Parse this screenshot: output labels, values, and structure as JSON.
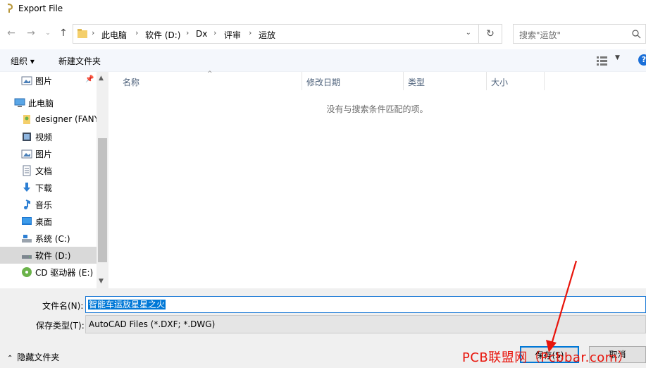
{
  "window": {
    "title": "Export File"
  },
  "nav": {
    "breadcrumbs": [
      "此电脑",
      "软件 (D:)",
      "Dx",
      "评审",
      "运放"
    ],
    "search_placeholder": "搜索\"运放\""
  },
  "toolbar": {
    "organize_label": "组织 ▾",
    "new_folder_label": "新建文件夹"
  },
  "sidebar": {
    "items": [
      {
        "label": "图片",
        "icon": "pictures-icon"
      },
      {
        "label": "此电脑",
        "icon": "computer-icon"
      },
      {
        "label": "designer (FANY",
        "icon": "user-folder-icon"
      },
      {
        "label": "视频",
        "icon": "video-icon"
      },
      {
        "label": "图片",
        "icon": "pictures-icon"
      },
      {
        "label": "文档",
        "icon": "documents-icon"
      },
      {
        "label": "下载",
        "icon": "download-icon"
      },
      {
        "label": "音乐",
        "icon": "music-icon"
      },
      {
        "label": "桌面",
        "icon": "desktop-icon"
      },
      {
        "label": "系统 (C:)",
        "icon": "drive-c-icon"
      },
      {
        "label": "软件 (D:)",
        "icon": "drive-d-icon"
      },
      {
        "label": "CD 驱动器 (E:) H",
        "icon": "cd-drive-icon"
      }
    ]
  },
  "filelist": {
    "columns": [
      "名称",
      "修改日期",
      "类型",
      "大小"
    ],
    "empty_message": "没有与搜索条件匹配的项。"
  },
  "form": {
    "filename_label": "文件名(N):",
    "filename_value": "智能车运放星星之火",
    "filetype_label": "保存类型(T):",
    "filetype_value": "AutoCAD Files (*.DXF; *.DWG)",
    "hide_folders_label": "隐藏文件夹",
    "save_label": "保存(S)",
    "cancel_label": "取消"
  },
  "overlay": {
    "watermark": "PCB联盟网（Pcbbar.com）"
  },
  "colors": {
    "accent": "#0078d7",
    "selection": "#cce4f7",
    "watermark": "#e8150c"
  }
}
